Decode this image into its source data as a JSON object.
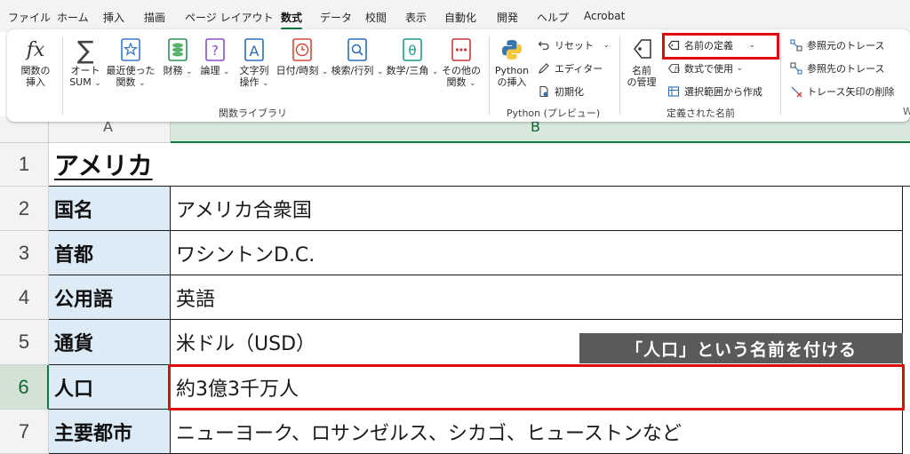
{
  "menu": {
    "tabs": [
      "ファイル",
      "ホーム",
      "挿入",
      "描画",
      "ページ レイアウト",
      "数式",
      "データ",
      "校閲",
      "表示",
      "自動化",
      "開発",
      "ヘルプ",
      "Acrobat"
    ],
    "active": "数式"
  },
  "ribbon": {
    "function_library": {
      "insert_function": {
        "glyph": "fx",
        "label1": "関数の",
        "label2": "挿入"
      },
      "autosum": {
        "glyph": "∑",
        "label1": "オート",
        "label2": "SUM"
      },
      "recent": {
        "label1": "最近使った",
        "label2": "関数"
      },
      "financial": {
        "label1": "財務"
      },
      "logical": {
        "label1": "論理"
      },
      "text": {
        "label1": "文字列",
        "label2": "操作"
      },
      "datetime": {
        "label1": "日付/時刻"
      },
      "lookup": {
        "label1": "検索/行列"
      },
      "math": {
        "label1": "数学/三角"
      },
      "more": {
        "label1": "その他の",
        "label2": "関数"
      },
      "group_label": "関数ライブラリ"
    },
    "python": {
      "insert": {
        "label1": "Python",
        "label2": "の挿入"
      },
      "reset": "リセット",
      "editor": "エディター",
      "initialize": "初期化",
      "group_label": "Python (プレビュー)"
    },
    "defined_names": {
      "name_manager": {
        "label1": "名前",
        "label2": "の管理"
      },
      "define_name": "名前の定義",
      "use_in_formula": "数式で使用",
      "create_from_selection": "選択範囲から作成",
      "group_label": "定義された名前"
    },
    "auditing": {
      "trace_precedents": "参照元のトレース",
      "trace_dependents": "参照先のトレース",
      "remove_arrows": "トレース矢印の削除",
      "cut_letter": "W"
    }
  },
  "sheet": {
    "columns": [
      "A",
      "B"
    ],
    "title": "アメリカ",
    "rows": [
      {
        "num": "1"
      },
      {
        "num": "2",
        "label": "国名",
        "value": "アメリカ合衆国"
      },
      {
        "num": "3",
        "label": "首都",
        "value": "ワシントンD.C."
      },
      {
        "num": "4",
        "label": "公用語",
        "value": "英語"
      },
      {
        "num": "5",
        "label": "通貨",
        "value": "米ドル（USD）"
      },
      {
        "num": "6",
        "label": "人口",
        "value": "約3億3千万人"
      },
      {
        "num": "7",
        "label": "主要都市",
        "value": "ニューヨーク、ロサンゼルス、シカゴ、ヒューストンなど"
      }
    ]
  },
  "annotation": {
    "caption": "「人口」という名前を付ける",
    "highlight_color": "#e00b0b"
  },
  "colors": {
    "accent_green": "#107c41",
    "label_fill": "#ddebf7"
  }
}
